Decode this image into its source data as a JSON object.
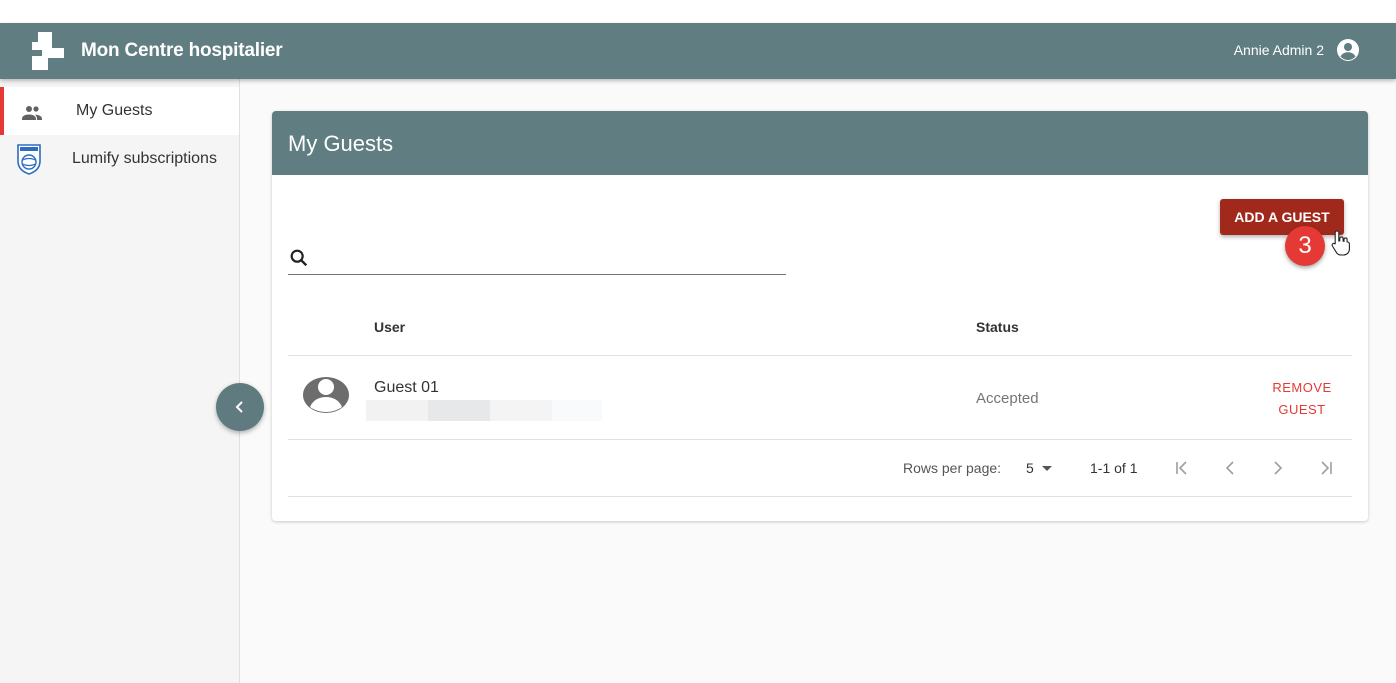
{
  "app": {
    "title": "Mon Centre hospitalier",
    "user_name": "Annie Admin 2",
    "brand_color": "#607d82"
  },
  "sidebar": {
    "items": [
      {
        "label": "My Guests",
        "icon": "people-icon",
        "active": true
      },
      {
        "label": "Lumify subscriptions",
        "icon": "philips-shield-icon",
        "active": false
      }
    ]
  },
  "page": {
    "title": "My Guests",
    "add_button_label": "ADD A GUEST",
    "step_badge": "3",
    "search": {
      "value": "",
      "placeholder": ""
    }
  },
  "table": {
    "columns": [
      "User",
      "Status"
    ],
    "rows": [
      {
        "user": "Guest 01",
        "status": "Accepted",
        "action_line1": "REMOVE",
        "action_line2": "GUEST"
      }
    ]
  },
  "pagination": {
    "rows_per_page_label": "Rows per page:",
    "rows_per_page_value": "5",
    "range": "1-1 of 1"
  }
}
